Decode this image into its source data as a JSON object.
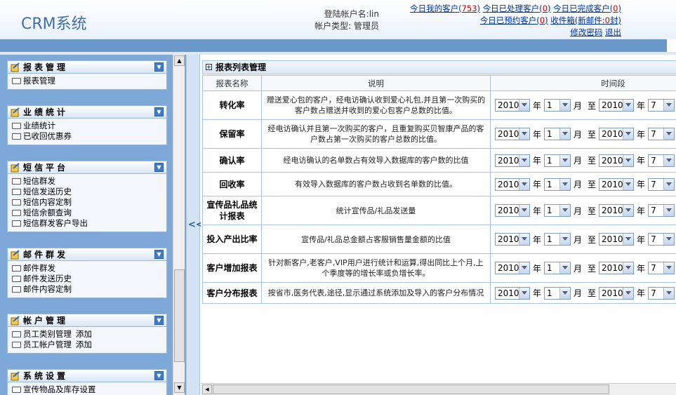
{
  "app": {
    "logo": "CRM系统"
  },
  "header": {
    "login_account": "登陆帐户名:lin",
    "account_type": "帐户类型: 管理员",
    "stats": {
      "my_customers_label": "今日我的客户(",
      "my_customers_count": "753",
      "processed_label": "今日已处理客户(",
      "processed_count": "0",
      "completed_label": "今日已完成客户(",
      "completed_count": "0",
      "reserved_label": "今日已预约客户(",
      "reserved_count": "0",
      "inbox_label": "收件箱(新邮件:",
      "inbox_count": "0",
      "inbox_suffix": "封)",
      "change_password": "修改密码",
      "logout": "退出",
      "close_paren": ")"
    }
  },
  "sidebar": {
    "groups": [
      {
        "title": "报表管理",
        "items": [
          {
            "label": "报表管理"
          }
        ]
      },
      {
        "title": "业绩统计",
        "items": [
          {
            "label": "业绩统计"
          },
          {
            "label": "已收回优惠券"
          }
        ]
      },
      {
        "title": "短信平台",
        "items": [
          {
            "label": "短信群发"
          },
          {
            "label": "短信发送历史"
          },
          {
            "label": "短信内容定制"
          },
          {
            "label": "短信余额查询"
          },
          {
            "label": "短信群发客户导出"
          }
        ]
      },
      {
        "title": "邮件群发",
        "items": [
          {
            "label": "邮件群发"
          },
          {
            "label": "邮件发送历史"
          },
          {
            "label": "邮件内容定制"
          }
        ]
      },
      {
        "title": "帐户管理",
        "items": [
          {
            "label": "员工类别管理",
            "add": "添加"
          },
          {
            "label": "员工帐户管理",
            "add": "添加"
          }
        ]
      },
      {
        "title": "系统设置",
        "items": [
          {
            "label": "宣传物品及库存设置"
          }
        ]
      }
    ],
    "splitter_label": "<<"
  },
  "main": {
    "panel_title": "报表列表管理",
    "columns": {
      "name": "报表名称",
      "desc": "说明",
      "time": "时间段"
    },
    "time_units": {
      "year": "年",
      "month": "月",
      "to": "至"
    },
    "rows": [
      {
        "name": "转化率",
        "desc": "赠送爱心包的客户，经电访确认收到爱心礼包,并且第一次购买的客户数占赠送并收到的爱心包客户总数的比值。",
        "year_from": "2010",
        "month_from": "1",
        "year_to": "2010",
        "month_to": "7"
      },
      {
        "name": "保留率",
        "desc": "经电访确认并且第一次购买的客户，且重复购买贝智康产品的客户数占第一次购买的客户总数的比值。",
        "year_from": "2010",
        "month_from": "1",
        "year_to": "2010",
        "month_to": "7"
      },
      {
        "name": "确认率",
        "desc": "经电访确认的名单数占有效导入数据库的客户数的比值",
        "year_from": "2010",
        "month_from": "1",
        "year_to": "2010",
        "month_to": "7"
      },
      {
        "name": "回收率",
        "desc": "有效导入数据库的客户数占收到名单数的比值。",
        "year_from": "2010",
        "month_from": "1",
        "year_to": "2010",
        "month_to": "7"
      },
      {
        "name": "宣传品礼品统计报表",
        "desc": "统计宣传品/礼品发送量",
        "year_from": "2010",
        "month_from": "1",
        "year_to": "2010",
        "month_to": "7"
      },
      {
        "name": "投入产出比率",
        "desc": "宣传品/礼品总金额占客服销售量金额的比值",
        "year_from": "2010",
        "month_from": "1",
        "year_to": "2010",
        "month_to": "7"
      },
      {
        "name": "客户增加报表",
        "desc": "针对新客户,老客户,VIP用户进行统计和运算,得出同比上个月,上个季度等的增长率或负增长率。",
        "year_from": "2010",
        "month_from": "1",
        "year_to": "2010",
        "month_to": "7"
      },
      {
        "name": "客户分布报表",
        "desc": "按省市,医务代表,途径,显示通过系统添加及导入的客户分布情况",
        "year_from": "2010",
        "month_from": "1",
        "year_to": "2010",
        "month_to": "7"
      }
    ]
  }
}
